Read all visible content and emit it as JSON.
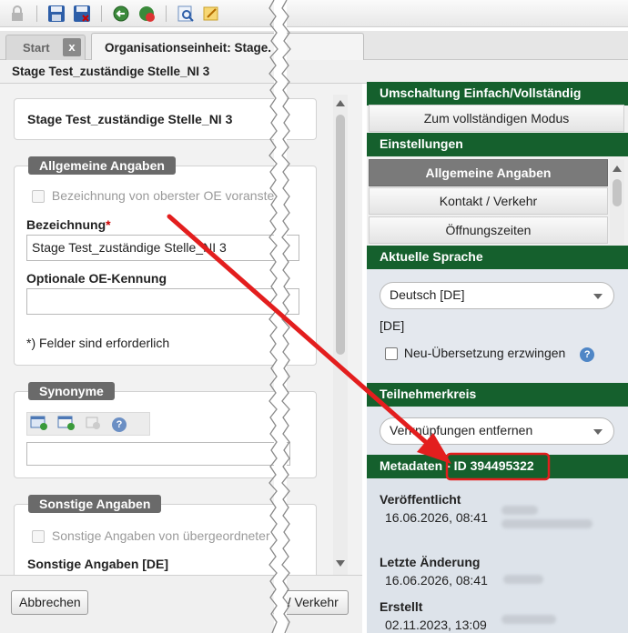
{
  "toolbar": {
    "icons": [
      "lock-icon",
      "save-icon",
      "save-close-icon",
      "globe-back-icon",
      "globe-refresh-icon",
      "preview-icon",
      "edit-icon"
    ]
  },
  "tabs": {
    "start": "Start",
    "close": "x",
    "active": "Organisationseinheit: Stage."
  },
  "page_title": "Stage Test_zuständige Stelle_NI 3",
  "left": {
    "header_box": "Stage Test_zuständige Stelle_NI 3",
    "general": {
      "legend": "Allgemeine Angaben",
      "prefix_checkbox": "Bezeichnung von oberster OE voranstell",
      "name_label": "Bezeichnung",
      "required_mark": "*",
      "name_value": "Stage Test_zuständige Stelle_NI 3",
      "optional_label": "Optionale OE-Kennung",
      "optional_value": "",
      "required_note": "*) Felder sind erforderlich"
    },
    "synonyms": {
      "legend": "Synonyme"
    },
    "other": {
      "legend": "Sonstige Angaben",
      "inherit_checkbox": "Sonstige Angaben von übergeordneter C",
      "label": "Sonstige Angaben [DE]"
    },
    "buttons": {
      "cancel": "Abbrechen",
      "next": "t / Verkehr"
    }
  },
  "right": {
    "mode_header": "Umschaltung Einfach/Vollständig",
    "full_mode_button": "Zum vollständigen Modus",
    "settings_header": "Einstellungen",
    "settings_items": [
      "Allgemeine Angaben",
      "Kontakt / Verkehr",
      "Öffnungszeiten"
    ],
    "language_header": "Aktuelle Sprache",
    "language_value": "Deutsch [DE]",
    "language_code": "[DE]",
    "force_translation": "Neu-Übersetzung erzwingen",
    "participants_header": "Teilnehmerkreis",
    "participants_value": "Verknüpfungen entfernen",
    "metadata_header": "Metadaten - ID 394495322",
    "published_label": "Veröffentlicht",
    "published_value": "16.06.2026, 08:41",
    "changed_label": "Letzte Änderung",
    "changed_value": "16.06.2026, 08:41",
    "created_label": "Erstellt",
    "created_value": "02.11.2023, 13:09"
  },
  "colors": {
    "header_green": "#15602d",
    "annotation_red": "#e31e1e"
  }
}
